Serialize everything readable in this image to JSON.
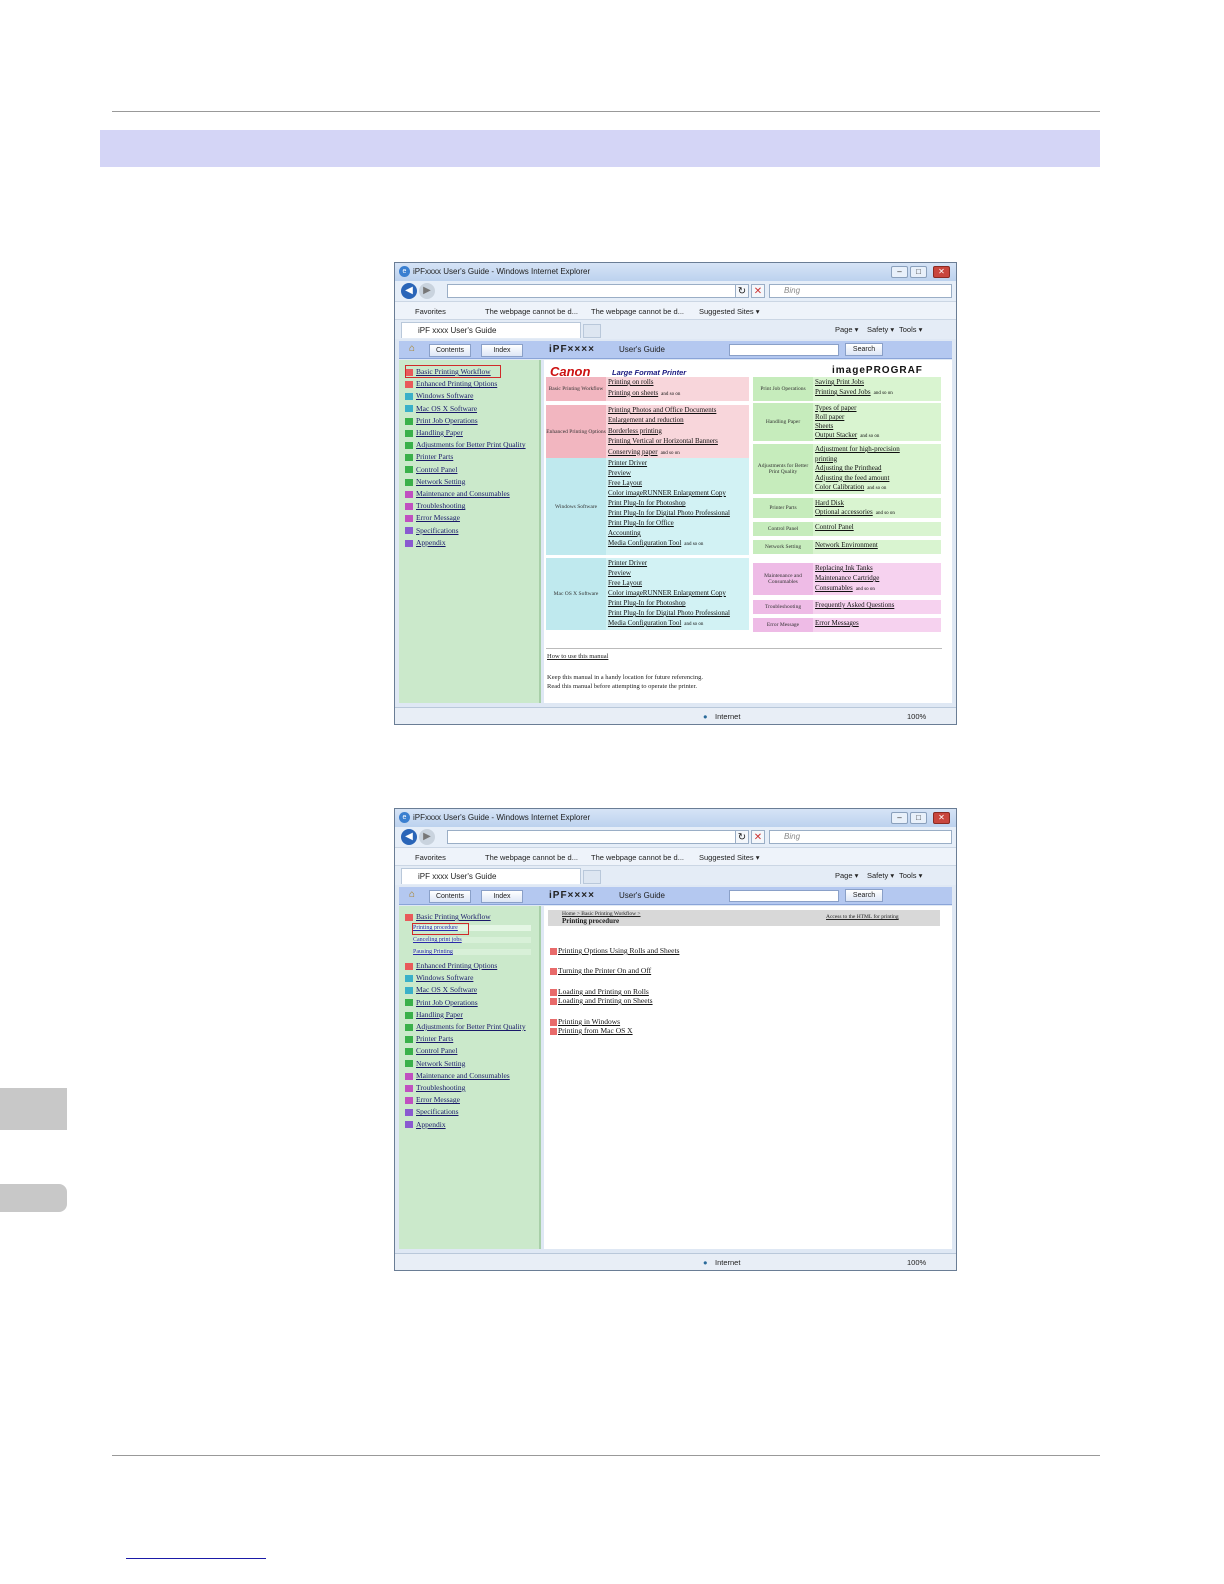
{
  "shot1": {
    "title": "iPFxxxx  User's Guide - Windows Internet Explorer",
    "search_placeholder": "Bing",
    "favorites": "Favorites",
    "fav1": "The webpage cannot be d...",
    "fav2": "The webpage cannot be d...",
    "suggested": "Suggested Sites ▾",
    "tab": "iPF xxxx  User's Guide",
    "cmd": [
      "Page ▾",
      "Safety ▾",
      "Tools ▾"
    ],
    "hdr": {
      "contents": "Contents",
      "index": "Index",
      "product": "iPF××××",
      "guide": "User's Guide",
      "search": "Search"
    },
    "status": {
      "zone": "Internet",
      "zoom": "100%"
    },
    "sidebar": [
      "Basic Printing Workflow",
      "Enhanced Printing Options",
      "Windows Software",
      "Mac OS X Software",
      "Print Job Operations",
      "Handling Paper",
      "Adjustments for Better Print Quality",
      "Printer Parts",
      "Control Panel",
      "Network Setting",
      "Maintenance and Consumables",
      "Troubleshooting",
      "Error Message",
      "Specifications",
      "Appendix"
    ],
    "sidebar_colors": [
      "#e85a5a",
      "#e85a5a",
      "#3ab0c8",
      "#3ab0c8",
      "#3ab04a",
      "#3ab04a",
      "#3ab04a",
      "#3ab04a",
      "#3ab04a",
      "#3ab04a",
      "#c050c0",
      "#c050c0",
      "#c050c0",
      "#8a5ad0",
      "#8a5ad0"
    ],
    "brand": "Canon",
    "brand_sub": "Large Format Printer",
    "brand_right": "imagePROGRAF",
    "boxes_left": [
      {
        "label": "Basic Printing Workflow",
        "links": [
          "Printing on rolls",
          "Printing on sheets"
        ],
        "color": "pink"
      },
      {
        "label": "Enhanced Printing Options",
        "links": [
          "Printing Photos and Office Documents",
          "Enlargement and reduction",
          "Borderless printing",
          "Printing Vertical or Horizontal Banners",
          "Conserving paper"
        ],
        "color": "pink"
      },
      {
        "label": "Windows Software",
        "links": [
          "Printer Driver",
          "Preview",
          "Free Layout",
          "Color imageRUNNER Enlargement Copy",
          "Print Plug-In for Photoshop",
          "Print Plug-In for Digital Photo Professional",
          "Print Plug-In for Office",
          "Accounting",
          "Media Configuration Tool"
        ],
        "color": "cyan"
      },
      {
        "label": "Mac OS X Software",
        "links": [
          "Printer Driver",
          "Preview",
          "Free Layout",
          "Color imageRUNNER Enlargement Copy",
          "Print Plug-In for Photoshop",
          "Print Plug-In for Digital Photo Professional",
          "Media Configuration Tool"
        ],
        "color": "cyan"
      }
    ],
    "boxes_right": [
      {
        "label": "Print Job Operations",
        "links": [
          "Saving Print Jobs",
          "Printing Saved Jobs"
        ],
        "color": "green"
      },
      {
        "label": "Handling Paper",
        "links": [
          "Types of paper",
          "Roll paper",
          "Sheets",
          "Output Stacker"
        ],
        "color": "green"
      },
      {
        "label": "Adjustments for Better Print Quality",
        "links": [
          "Adjustment for high-precision",
          "printing",
          "Adjusting the Printhead",
          "Adjusting the feed amount",
          "Color Calibration"
        ],
        "color": "green"
      },
      {
        "label": "Printer Parts",
        "links": [
          "Hard Disk",
          "Optional accessories"
        ],
        "color": "green"
      },
      {
        "label": "Control Panel",
        "links": [
          "Control Panel"
        ],
        "color": "green"
      },
      {
        "label": "Network Setting",
        "links": [
          "Network Environment"
        ],
        "color": "green"
      },
      {
        "label": "Maintenance and Consumables",
        "links": [
          "Replacing Ink Tanks",
          "Maintenance Cartridge",
          "Consumables"
        ],
        "color": "mag"
      },
      {
        "label": "Troubleshooting",
        "links": [
          "Frequently Asked Questions"
        ],
        "color": "mag"
      },
      {
        "label": "Error Message",
        "links": [
          "Error Messages"
        ],
        "color": "mag"
      }
    ],
    "and_so_on": "and so on",
    "how_to": "How to use this manual",
    "keep1": "Keep this manual in a handy location for future referencing.",
    "keep2": "Read this manual before attempting to operate the printer."
  },
  "shot2": {
    "title": "iPFxxxx  User's Guide - Windows Internet Explorer",
    "tab": "iPF xxxx  User's Guide",
    "subitems": [
      "Printing procedure",
      "Canceling print jobs",
      "Pausing Printing"
    ],
    "breadcrumb": "Home > Basic Printing Workflow >",
    "page_title": "Printing procedure",
    "html_link": "Access to the HTML for printing",
    "procs": [
      "Printing Options Using Rolls and Sheets",
      "Turning the Printer On and Off",
      "Loading and Printing on Rolls",
      "Loading and Printing on Sheets",
      "Printing in Windows",
      "Printing from Mac OS X"
    ]
  }
}
